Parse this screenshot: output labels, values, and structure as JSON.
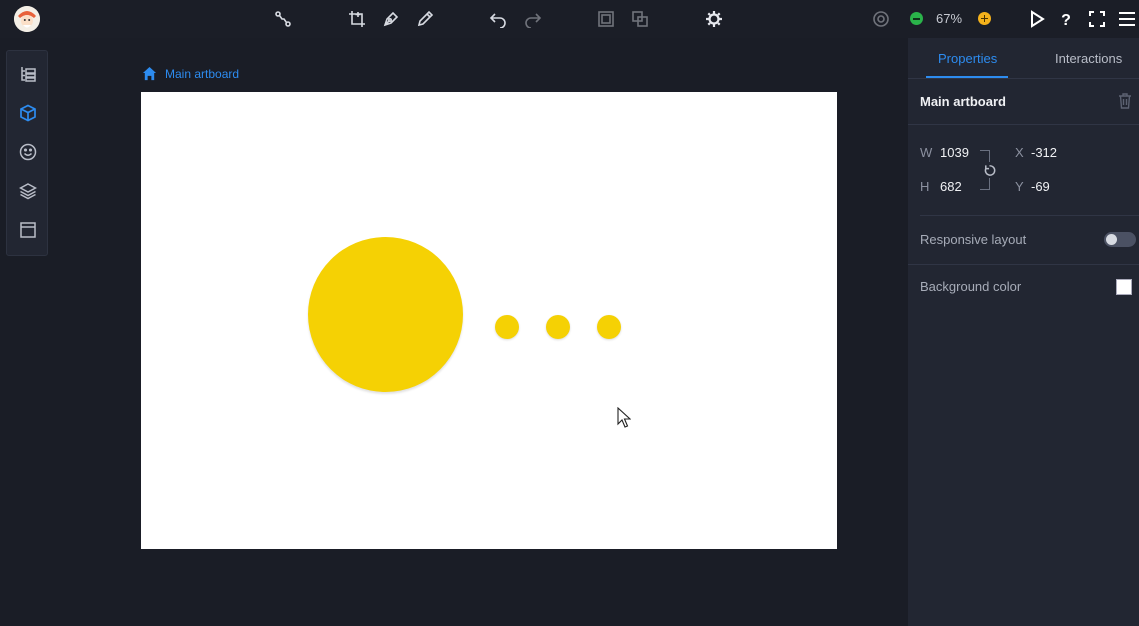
{
  "toolbar": {
    "zoom_level": "67%",
    "icons": [
      "connector-icon",
      "crop-artboard-icon",
      "pen-icon",
      "pencil-icon",
      "undo-icon",
      "redo-icon",
      "group-icon",
      "ungroup-icon",
      "settings-icon",
      "preview-target-icon",
      "zoom-out-icon",
      "zoom-in-icon",
      "play-icon",
      "help-icon",
      "fullscreen-icon",
      "menu-icon"
    ]
  },
  "leftpanel": {
    "icons": [
      "layers-tree-icon",
      "components-cube-icon",
      "emoji-icon",
      "stack-icon",
      "panel-icon"
    ],
    "active": "components-cube-icon"
  },
  "breadcrumb": {
    "label": "Main artboard"
  },
  "artboard": {
    "background": "#ffffff",
    "shape_color": "#f5d104"
  },
  "properties": {
    "tabs": [
      {
        "label": "Properties",
        "active": true
      },
      {
        "label": "Interactions",
        "active": false
      }
    ],
    "title": "Main artboard",
    "w_label": "W",
    "w_value": "1039",
    "h_label": "H",
    "h_value": "682",
    "x_label": "X",
    "x_value": "-312",
    "y_label": "Y",
    "y_value": "-69",
    "responsive_label": "Responsive layout",
    "responsive_on": false,
    "background_label": "Background color",
    "background_color": "#ffffff"
  },
  "colors": {
    "accent": "#2d8cf0",
    "zoom_out": "#2ab34a",
    "zoom_in": "#f5b21b"
  }
}
